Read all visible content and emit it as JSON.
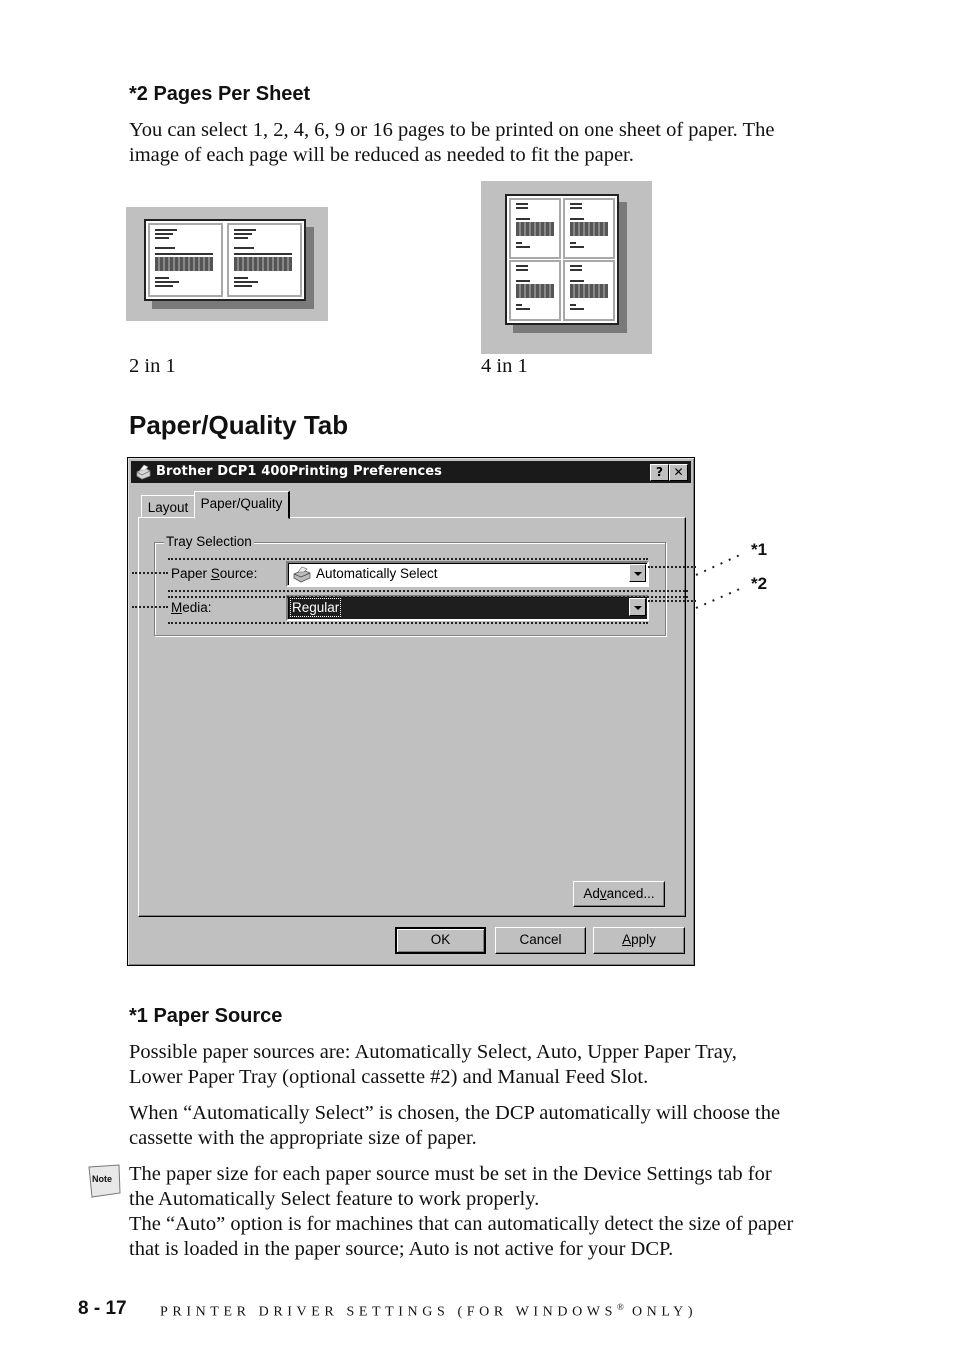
{
  "section_pages_per_sheet": {
    "heading": "*2 Pages Per Sheet",
    "body_line1": "You can select 1, 2, 4, 6, 9 or 16 pages to be printed on one sheet of paper. The",
    "body_line2": "image of each page will be reduced as needed to fit the paper.",
    "thumbnails": [
      {
        "caption": "2 in 1",
        "pages": 2
      },
      {
        "caption": "4 in 1",
        "pages": 4
      }
    ]
  },
  "section_paper_quality": {
    "heading": "Paper/Quality Tab"
  },
  "dialog": {
    "title": "Brother DCP1 400Printing Preferences",
    "title_icon": "printer-icon",
    "help_button": "?",
    "close_button": "✕",
    "tabs": [
      {
        "label": "Layout",
        "active": false
      },
      {
        "label": "Paper/Quality",
        "active": true
      }
    ],
    "group_label": "Tray Selection",
    "paper_source": {
      "label_pre": "Paper ",
      "label_accel": "S",
      "label_post": "ource:",
      "value": "Automatically Select",
      "value_icon": "printer-icon"
    },
    "media": {
      "label_accel": "M",
      "label_post": "edia:",
      "value": "Regular"
    },
    "advanced_button": {
      "pre": "Ad",
      "accel": "v",
      "post": "anced..."
    },
    "ok_button": "OK",
    "cancel_button": "Cancel",
    "apply_button": {
      "accel": "A",
      "post": "pply"
    }
  },
  "callouts": [
    "*1",
    "*2"
  ],
  "section_paper_source": {
    "heading": "*1 Paper Source",
    "para1_line1": "Possible paper sources are: Automatically Select, Auto, Upper Paper Tray,",
    "para1_line2": "Lower Paper Tray (optional cassette #2) and Manual Feed Slot.",
    "para2_line1": "When “Automatically Select” is chosen, the DCP automatically will choose the",
    "para2_line2": "cassette with the appropriate size of paper."
  },
  "note": {
    "icon_label": "Note",
    "line1": "The paper size for each paper source must be set in the Device Settings tab for",
    "line2": "the Automatically Select feature to work properly.",
    "line3": "The “Auto” option is for machines that can automatically detect the size of paper",
    "line4": "that is loaded in the paper source; Auto is not active for your DCP."
  },
  "footer": {
    "page_number": "8 - 17",
    "running_title": "PRINTER DRIVER SETTINGS (FOR WINDOWS",
    "registered_mark": "®",
    "running_title_end": " ONLY)"
  }
}
